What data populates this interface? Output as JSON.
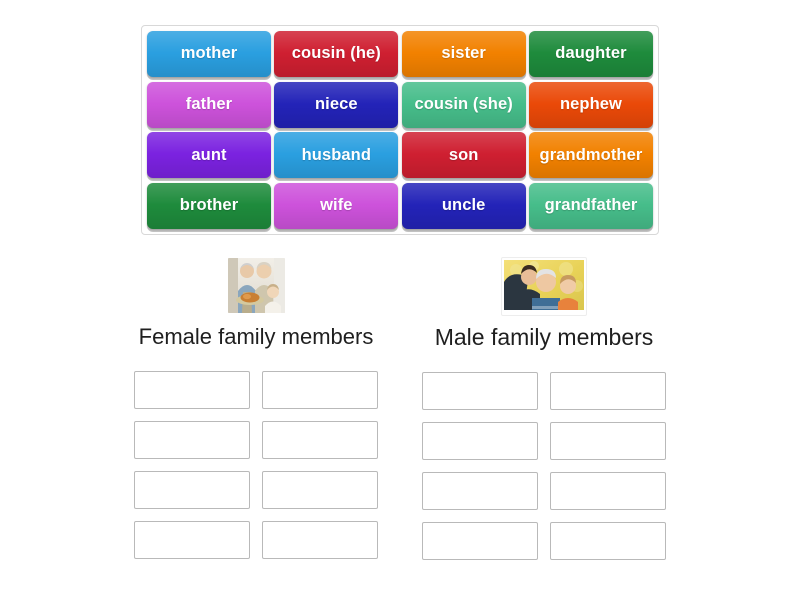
{
  "activity": {
    "type": "group-sort",
    "tile_bank": {
      "name": "word-tile-bank",
      "rows": [
        [
          {
            "label": "mother",
            "color": "#2a9fe0"
          },
          {
            "label": "cousin (he)",
            "color": "#cf1f31"
          },
          {
            "label": "sister",
            "color": "#f28100"
          },
          {
            "label": "daughter",
            "color": "#1e8b3c"
          }
        ],
        [
          {
            "label": "father",
            "color": "#cd52db"
          },
          {
            "label": "niece",
            "color": "#2323b8"
          },
          {
            "label": "cousin (she)",
            "color": "#46bd8a"
          },
          {
            "label": "nephew",
            "color": "#ea4908"
          }
        ],
        [
          {
            "label": "aunt",
            "color": "#7b22e0"
          },
          {
            "label": "husband",
            "color": "#2a9fe0"
          },
          {
            "label": "son",
            "color": "#cf1f31"
          },
          {
            "label": "grandmother",
            "color": "#f28100"
          }
        ],
        [
          {
            "label": "brother",
            "color": "#1e8b3c"
          },
          {
            "label": "wife",
            "color": "#cd52db"
          },
          {
            "label": "uncle",
            "color": "#2323b8"
          },
          {
            "label": "grandfather",
            "color": "#46bd8a"
          }
        ]
      ]
    },
    "categories": [
      {
        "key": "female",
        "title": "Female family members",
        "image_alt": "photo-of-female-family-members",
        "dropzone_count": 8,
        "dropzone_values": [
          "",
          "",
          "",
          "",
          "",
          "",
          "",
          ""
        ]
      },
      {
        "key": "male",
        "title": "Male family members",
        "image_alt": "photo-of-male-family-members",
        "dropzone_count": 8,
        "dropzone_values": [
          "",
          "",
          "",
          "",
          "",
          "",
          "",
          ""
        ]
      }
    ],
    "colors": {
      "background": "#ffffff",
      "bank_border": "#d8d8d8",
      "dropzone_border": "#b9b9b9",
      "title_text": "#1f1f1f",
      "tile_text": "#ffffff"
    }
  }
}
